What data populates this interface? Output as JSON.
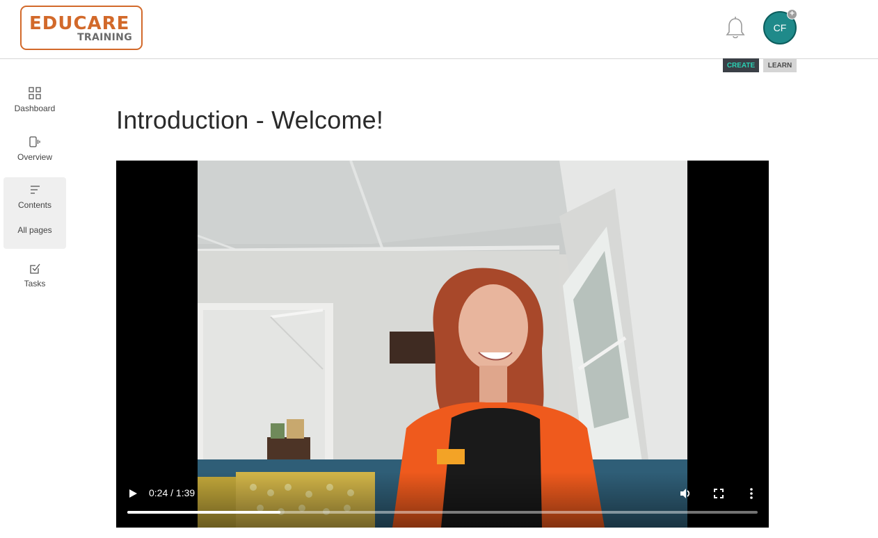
{
  "header": {
    "logo_top": "EDUCARE",
    "logo_bottom": "TRAINING",
    "avatar_initials": "CF",
    "mode_create": "CREATE",
    "mode_learn": "LEARN"
  },
  "sidebar": {
    "items": [
      {
        "label": "Dashboard",
        "icon": "grid-icon"
      },
      {
        "label": "Overview",
        "icon": "overview-icon"
      },
      {
        "label": "Contents",
        "icon": "contents-icon",
        "sub_label": "All pages",
        "active": true
      },
      {
        "label": "Tasks",
        "icon": "task-check-icon"
      }
    ]
  },
  "main": {
    "title": "Introduction - Welcome!"
  },
  "video": {
    "time": "0:24 / 1:39",
    "progress_fraction": 0.2424
  },
  "colors": {
    "brand_orange": "#d2692a",
    "create_accent": "#2ad1b4",
    "avatar_teal": "#1f8a8a"
  }
}
